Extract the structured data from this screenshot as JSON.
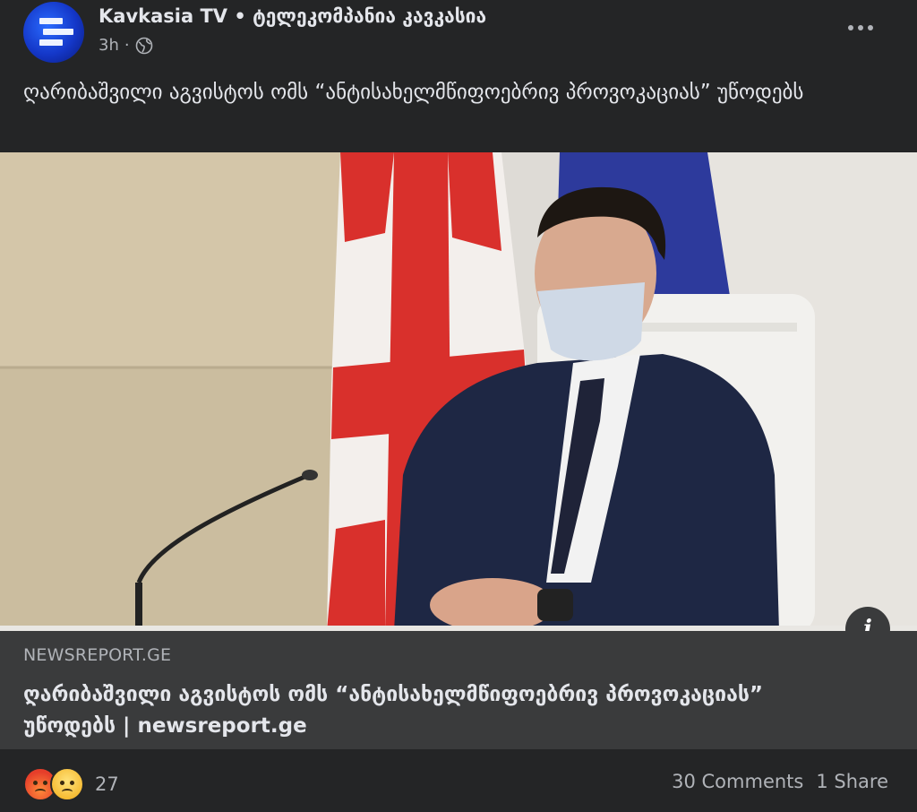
{
  "post": {
    "author": "Kavkasia TV • ტელეკომპანია კავკასია",
    "time": "3h",
    "separator": "·",
    "privacy_icon": "globe-icon",
    "more_icon": "more-options-icon",
    "text": "ღარიბაშვილი აგვისტოს ომს “ანტისახელმწიფოებრივ პროვოკაციას” უწოდებს"
  },
  "link_preview": {
    "domain": "NEWSREPORT.GE",
    "title": "ღარიბაშვილი აგვისტოს ომს “ანტისახელმწიფოებრივ პროვოკაციას” უწოდებს | newsreport.ge",
    "info_icon": "info-icon",
    "info_label": "i"
  },
  "engagement": {
    "reaction_icons": [
      "angry-reaction-icon",
      "sad-reaction-icon"
    ],
    "reaction_count": "27",
    "comments": "30 Comments",
    "shares": "1 Share"
  },
  "colors": {
    "background": "#242526",
    "link_box": "#3a3b3c",
    "primary_text": "#e4e6eb",
    "secondary_text": "#b0b3b8"
  }
}
